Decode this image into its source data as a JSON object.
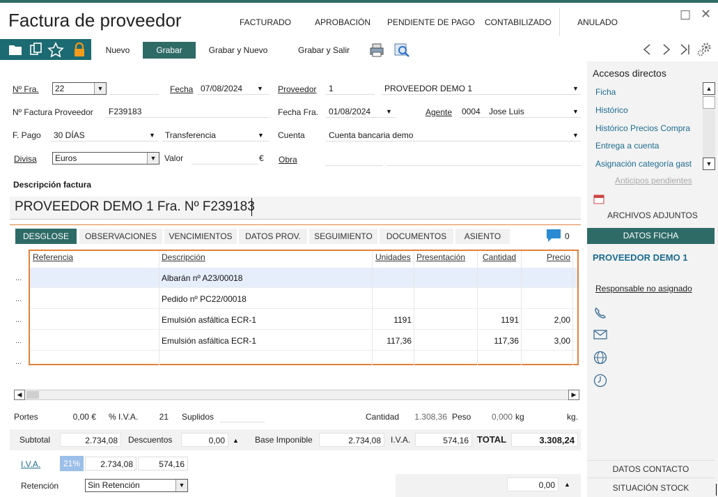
{
  "window": {
    "title": "Factura de proveedor",
    "close_glyph": "✕",
    "maximize_glyph": "☐"
  },
  "states": [
    "FACTURADO",
    "APROBACIÓN",
    "PENDIENTE DE PAGO",
    "CONTABILIZADO",
    "ANULADO"
  ],
  "toolbar": {
    "new_label": "Nuevo",
    "save_label": "Grabar",
    "save_new_label": "Grabar y Nuevo",
    "save_exit_label": "Grabar y Salir"
  },
  "form": {
    "nfra_label": "Nº Fra.",
    "nfra_value": "22",
    "fecha_label": "Fecha",
    "fecha_value": "07/08/2024",
    "proveedor_label": "Proveedor",
    "proveedor_code": "1",
    "proveedor_name": "PROVEEDOR DEMO 1",
    "nfactprov_label": "Nº Factura Proveedor",
    "nfactprov_value": "F239183",
    "fechafra_label": "Fecha Fra.",
    "fechafra_value": "01/08/2024",
    "agente_label": "Agente",
    "agente_code": "0004",
    "agente_name": "Jose Luis",
    "fpago_label": "F. Pago",
    "fpago_value": "30 DÍAS",
    "medio_value": "Transferencia",
    "cuenta_label": "Cuenta",
    "cuenta_value": "Cuenta bancaria demo",
    "divisa_label": "Divisa",
    "divisa_value": "Euros",
    "valor_label": "Valor",
    "valor_symbol": "€",
    "obra_label": "Obra",
    "descripcion_label": "Descripción factura",
    "descripcion_value": "PROVEEDOR DEMO 1 Fra. Nº F239183"
  },
  "tabs": [
    "DESGLOSE",
    "OBSERVACIONES",
    "VENCIMIENTOS",
    "DATOS PROV.",
    "SEGUIMIENTO",
    "DOCUMENTOS",
    "ASIENTO"
  ],
  "comments_count": "0",
  "grid": {
    "headers": [
      "Referencia",
      "Descripción",
      "Unidades",
      "Presentación",
      "Cantidad",
      "Precio"
    ],
    "row_marker": "...",
    "rows": [
      {
        "descripcion": "Albarán nº A23/00018",
        "unidades": "",
        "cantidad": "",
        "precio": ""
      },
      {
        "descripcion": "Pedido nº PC22/00018",
        "unidades": "",
        "cantidad": "",
        "precio": ""
      },
      {
        "descripcion": "Emulsión asfáltica ECR-1",
        "unidades": "1191",
        "cantidad": "1191",
        "precio": "2,00"
      },
      {
        "descripcion": "Emulsión asfáltica ECR-1",
        "unidades": "117,36",
        "cantidad": "117,36",
        "precio": "3,00"
      },
      {
        "descripcion": "",
        "unidades": "",
        "cantidad": "",
        "precio": ""
      }
    ]
  },
  "footer": {
    "portes_label": "Portes",
    "portes_value": "0,00 €",
    "iva_pct_label": "% I.V.A.",
    "iva_pct_value": "21",
    "suplidos_label": "Suplidos",
    "cantidad_label": "Cantidad",
    "cantidad_value": "1.308,36",
    "peso_label": "Peso",
    "peso_value": "0,000",
    "peso_unit1": "kg",
    "peso_unit2": "kg.",
    "subtotal_label": "Subtotal",
    "subtotal_value": "2.734,08",
    "descuentos_label": "Descuentos",
    "descuentos_value": "0,00",
    "base_label": "Base Imponible",
    "base_value": "2.734,08",
    "iva_label": "I.V.A.",
    "iva_value": "574,16",
    "total_label": "TOTAL",
    "total_value": "3.308,24",
    "iva_row_label": "I.V.A.",
    "iva_row_pct": "21%",
    "iva_row_base": "2.734,08",
    "iva_row_amount": "574,16",
    "retencion_label": "Retención",
    "retencion_value": "Sin Retención",
    "retencion_amount": "0,00"
  },
  "sidebar": {
    "shortcuts_title": "Accesos directos",
    "links": [
      "Ficha",
      "Histórico",
      "Histórico Precios Compra",
      "Entrega a cuenta",
      "Asignación categoría gast"
    ],
    "anticipos": "Anticipos pendientes",
    "archivos": "ARCHIVOS ADJUNTOS",
    "datos_ficha": "DATOS FICHA",
    "proveedor": "PROVEEDOR DEMO 1",
    "responsable": "Responsable no asignado",
    "datos_contacto": "DATOS CONTACTO",
    "situacion_stock": "SITUACIÓN STOCK"
  },
  "colors": {
    "accent": "#2e6b67",
    "grid_border": "#e0823c",
    "link": "#1d6b8f",
    "folder": "#1c6a72",
    "lock": "#f29b1d"
  }
}
